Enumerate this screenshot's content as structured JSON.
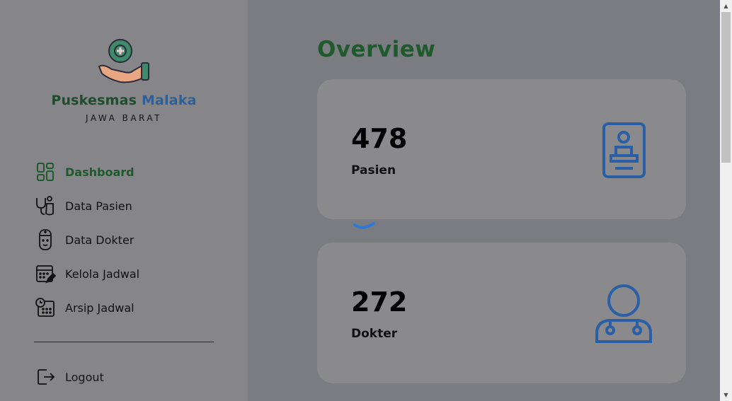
{
  "sidebar": {
    "brand": {
      "part1": "Puskesmas",
      "part2": "Malaka",
      "subtitle": "JAWA BARAT"
    },
    "items": [
      {
        "label": "Dashboard",
        "icon": "dashboard-grid-icon"
      },
      {
        "label": "Data Pasien",
        "icon": "stethoscope-icon"
      },
      {
        "label": "Data Dokter",
        "icon": "doctor-icon"
      },
      {
        "label": "Kelola Jadwal",
        "icon": "calendar-edit-icon"
      },
      {
        "label": "Arsip Jadwal",
        "icon": "calendar-clock-icon"
      }
    ],
    "logout": {
      "label": "Logout",
      "icon": "logout-icon"
    }
  },
  "main": {
    "title": "Overview",
    "cards": [
      {
        "value": "478",
        "label": "Pasien",
        "icon": "patient-id-card-icon"
      },
      {
        "value": "272",
        "label": "Dokter",
        "icon": "doctor-stethoscope-icon"
      }
    ]
  },
  "colors": {
    "brand_green": "#1f5a2c",
    "brand_blue": "#2f5f93",
    "icon_blue": "#2a5fa6"
  }
}
